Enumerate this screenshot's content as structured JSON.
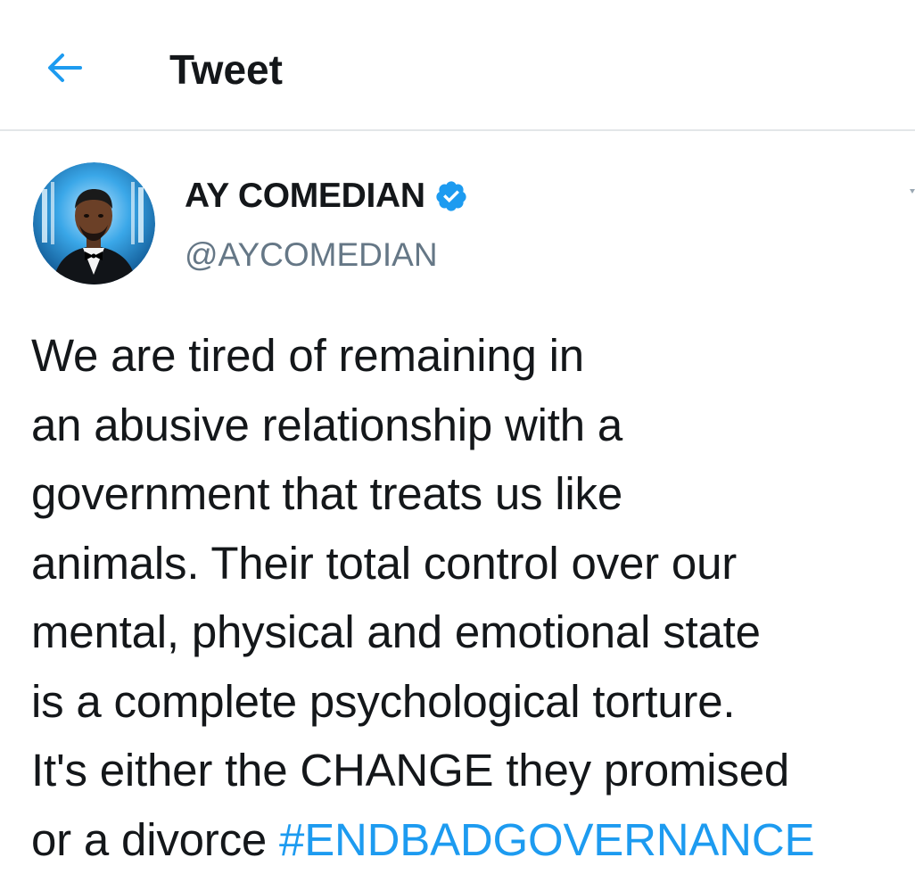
{
  "header": {
    "title": "Tweet",
    "back_icon": "arrow-left-icon",
    "accent_color": "#1d9bf0"
  },
  "author": {
    "display_name": "AY COMEDIAN",
    "handle": "@AYCOMEDIAN",
    "verified": true,
    "verified_icon": "verified-badge-icon",
    "avatar_icon": "profile-photo"
  },
  "tweet": {
    "lines": [
      "We are tired of remaining in",
      "an abusive relationship with a",
      "government that treats us like",
      "animals. Their total control over our",
      "mental, physical and emotional state",
      "is a complete psychological torture.",
      "It's either the CHANGE they promised"
    ],
    "last_line_prefix": "or a divorce ",
    "hashtag": "#ENDBADGOVERNANCE",
    "hashtag_color": "#1d9bf0"
  }
}
